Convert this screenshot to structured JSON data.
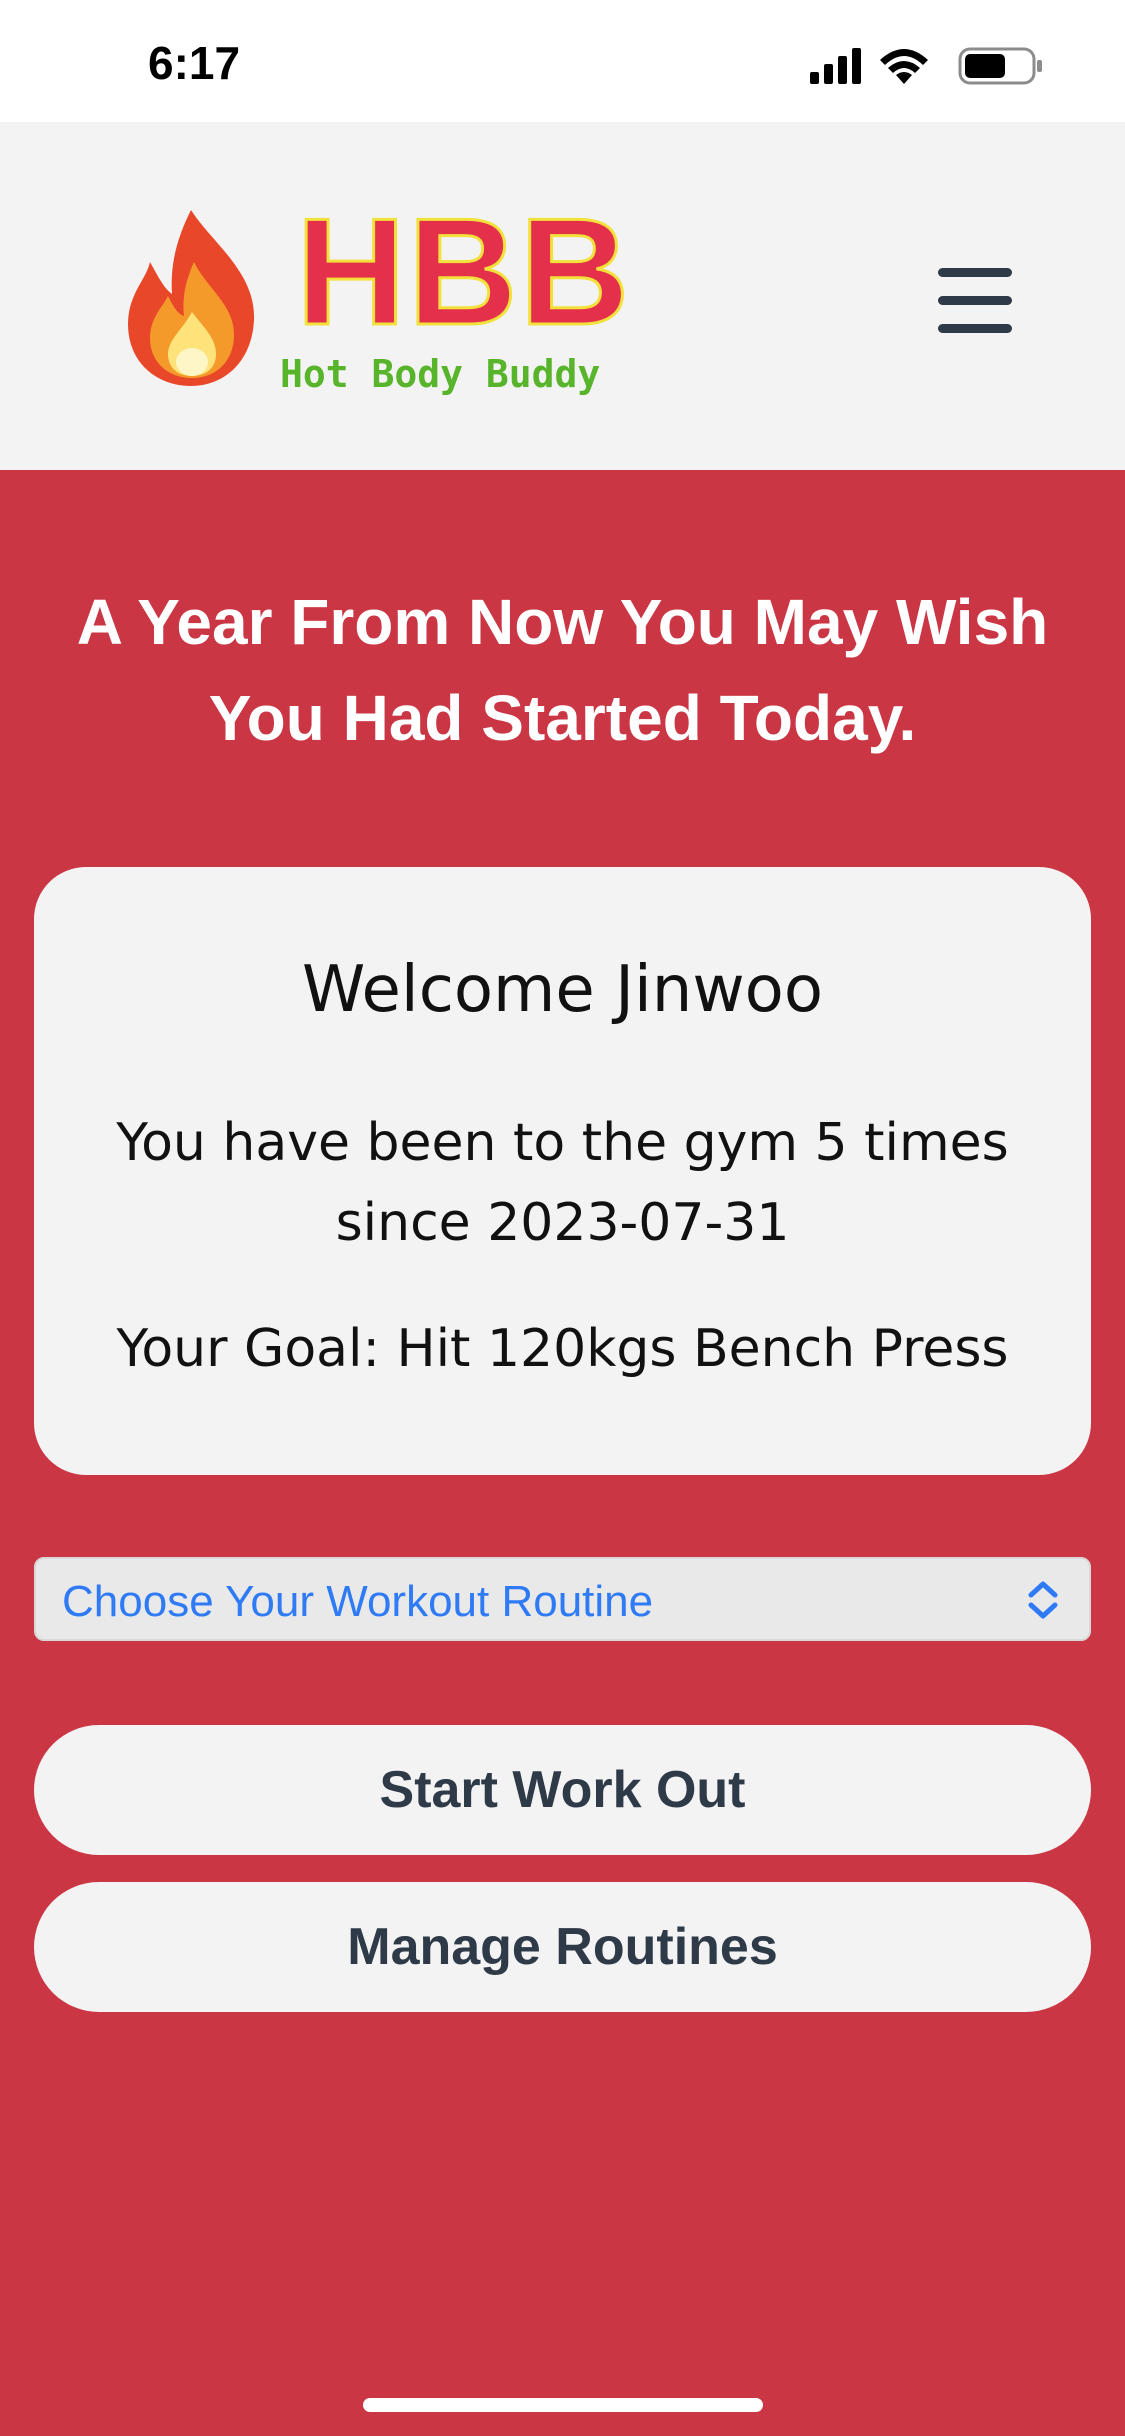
{
  "status_bar": {
    "time": "6:17",
    "icons": [
      "signal-icon",
      "wifi-icon",
      "battery-icon"
    ]
  },
  "header": {
    "logo": {
      "title": "HBB",
      "subtitle": "Hot Body Buddy",
      "icon": "flame-icon"
    },
    "menu_icon": "hamburger-menu-icon"
  },
  "hero": {
    "line1": "A Year From Now You May Wish",
    "line2": "You Had Started Today."
  },
  "welcome_card": {
    "greeting": "Welcome Jinwoo",
    "visits_line1": "You have been to the gym 5 times",
    "visits_line2": "since 2023-07-31",
    "goal": "Your Goal: Hit 120kgs Bench Press"
  },
  "routine_select": {
    "selected": "Choose Your Workout Routine",
    "icon": "chevron-updown-icon"
  },
  "buttons": {
    "start": "Start Work Out",
    "manage": "Manage Routines"
  },
  "colors": {
    "background": "#CB3645",
    "header": "#F3F3F3",
    "card": "#F3F3F3",
    "select_text": "#2F7BF5",
    "button_text": "#2E3A47",
    "logo_red": "#E5304C",
    "logo_green": "#58B42A"
  }
}
